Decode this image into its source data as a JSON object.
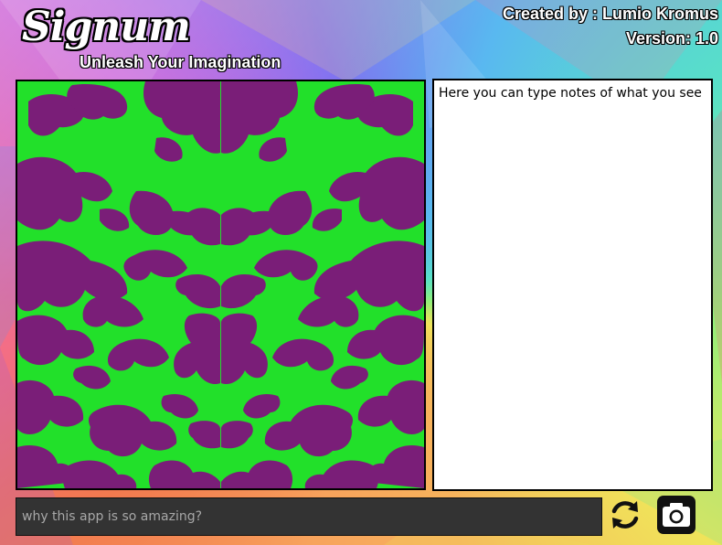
{
  "app": {
    "logo_text": "Signum",
    "tagline": "Unleash Your Imagination",
    "credits_line": "Created  by : Lumio Kromus",
    "version_line": "Version: 1.0"
  },
  "inkblot": {
    "background_color": "#22e02a",
    "blot_color": "#7a1e78"
  },
  "notes": {
    "placeholder": "Here you can type notes of what you see",
    "value": ""
  },
  "question_input": {
    "placeholder": "why this app is so amazing?",
    "value": ""
  },
  "icons": {
    "refresh": "refresh-icon",
    "camera": "camera-icon"
  }
}
